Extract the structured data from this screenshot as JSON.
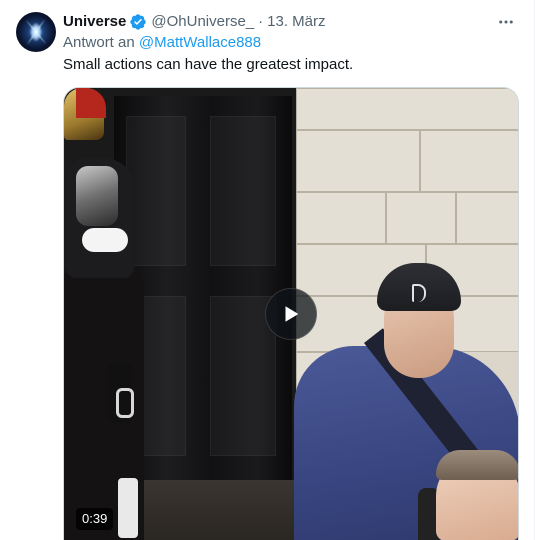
{
  "tweet": {
    "display_name": "Universe",
    "verified_icon": "verified-badge-icon",
    "handle": "@OhUniverse_",
    "separator": "·",
    "date": "13. März",
    "reply_prefix": "Antwort an",
    "reply_mention": "@MattWallace888",
    "text": "Small actions can have the greatest impact.",
    "more_icon": "more-options-icon"
  },
  "media": {
    "type": "video",
    "play_icon": "play-icon",
    "duration": "0:39"
  },
  "colors": {
    "accent": "#1d9bf0",
    "text": "#0f1419",
    "muted": "#536471"
  }
}
